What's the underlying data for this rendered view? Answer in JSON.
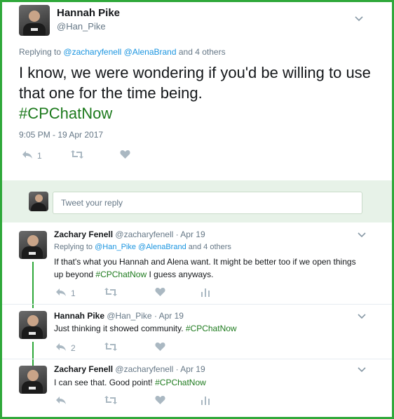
{
  "main_tweet": {
    "name": "Hannah Pike",
    "handle": "@Han_Pike",
    "replying_prefix": "Replying to",
    "replying_user1": "@zacharyfenell",
    "replying_user2": "@AlenaBrand",
    "replying_suffix": "and 4 others",
    "text": "I know, we were wondering if you'd be willing to use that one for the time being.",
    "hashtag": "#CPChatNow",
    "timestamp": "9:05 PM - 19 Apr 2017",
    "reply_count": "1"
  },
  "reply_box": {
    "placeholder": "Tweet your reply"
  },
  "replies": [
    {
      "name": "Zachary Fenell",
      "handle": "@zacharyfenell",
      "sep": "·",
      "date": "Apr 19",
      "replying_prefix": "Replying to",
      "replying_user1": "@Han_Pike",
      "replying_user2": "@AlenaBrand",
      "replying_suffix": "and 4 others",
      "text_line1": "If that's what you Hannah and Alena want. It might be better too if we open things",
      "text_line2_pre": "up beyond",
      "hashtag": "#CPChatNow",
      "text_line2_post": "I guess anyways.",
      "reply_count": "1"
    },
    {
      "name": "Hannah Pike",
      "handle": "@Han_Pike",
      "sep": "·",
      "date": "Apr 19",
      "text_pre": "Just thinking it showed community.",
      "hashtag": "#CPChatNow",
      "reply_count": "2"
    },
    {
      "name": "Zachary Fenell",
      "handle": "@zacharyfenell",
      "sep": "·",
      "date": "Apr 19",
      "text_pre": "I can see that. Good point!",
      "hashtag": "#CPChatNow"
    }
  ],
  "colors": {
    "border": "#2fa83a",
    "hashtag": "#1d7a1d",
    "link": "#1b95e0",
    "reply_bg": "#e8f5fd"
  }
}
